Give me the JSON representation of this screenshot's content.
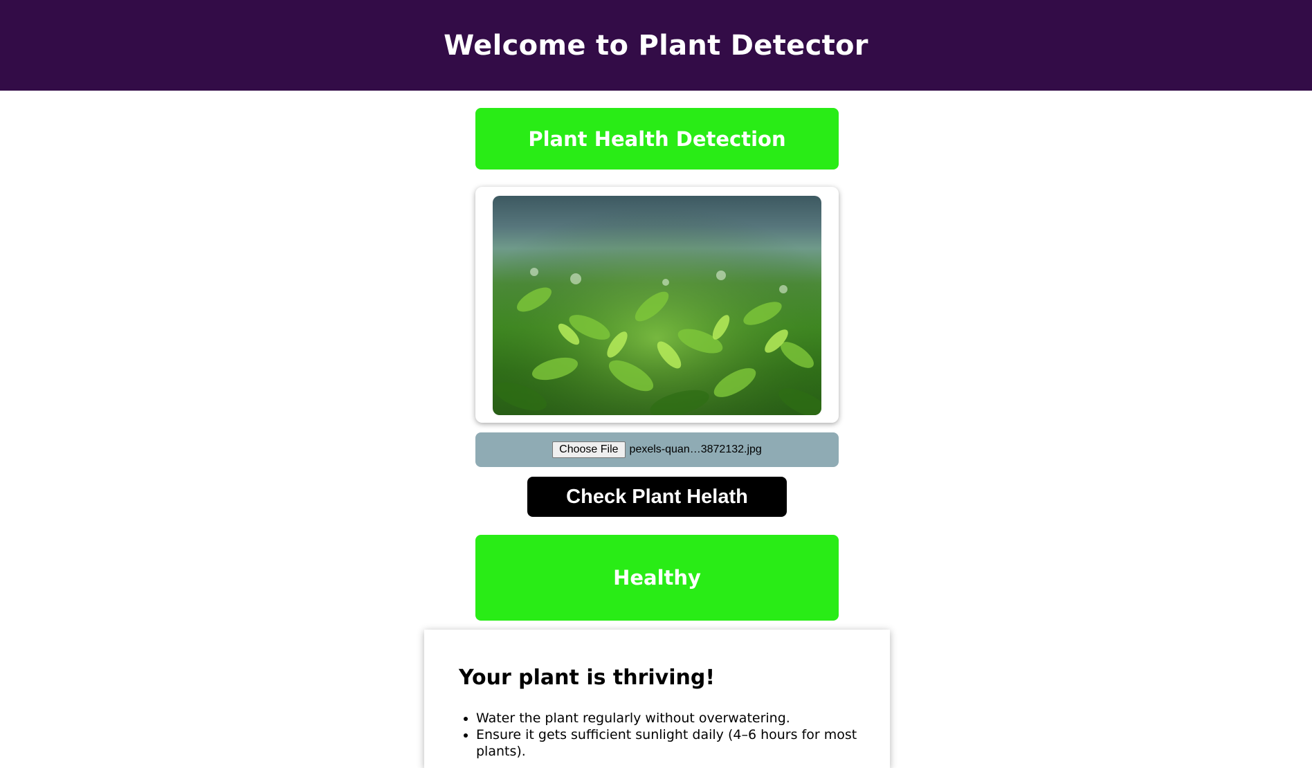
{
  "header": {
    "title": "Welcome to Plant Detector"
  },
  "section_title": "Plant Health Detection",
  "upload": {
    "choose_label": "Choose File",
    "file_name": "pexels-quan…3872132.jpg"
  },
  "check_button_label": "Check Plant Helath",
  "result": {
    "status": "Healthy"
  },
  "advice": {
    "heading": "Your plant is thriving!",
    "tips": [
      "Water the plant regularly without overwatering.",
      "Ensure it gets sufficient sunlight daily (4–6 hours for most plants)."
    ]
  },
  "colors": {
    "header_bg": "#330c47",
    "accent_green": "#29ec16",
    "file_bar_bg": "#8fabb4",
    "button_bg": "#000000"
  }
}
